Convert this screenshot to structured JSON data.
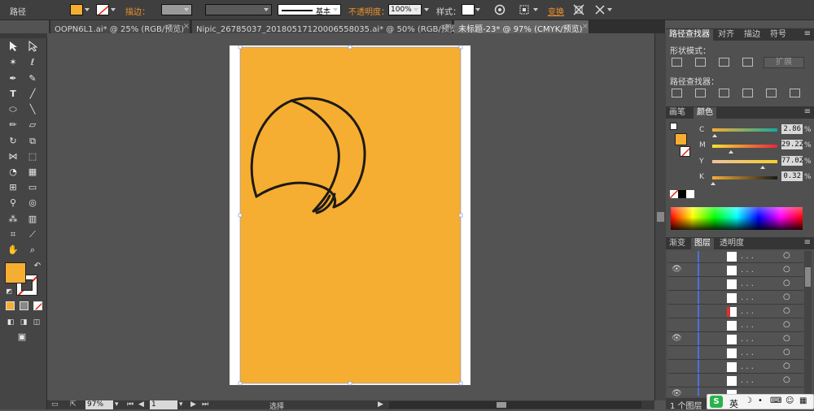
{
  "control": {
    "selection_label": "路径",
    "stroke_label": "描边：",
    "stroke_profile": "基本",
    "opacity_label": "不透明度：",
    "opacity": "100%",
    "style_label": "样式：",
    "transform_label": "变换",
    "fill_color": "#f6ae32"
  },
  "tabs": [
    {
      "label": "OOPN6L1.ai* @ 25% (RGB/预览)"
    },
    {
      "label": "Nipic_26785037_20180517120006558035.ai* @ 50% (RGB/预览)"
    },
    {
      "label": "未标题-23* @ 97% (CMYK/预览)"
    }
  ],
  "panels": {
    "pathfinder_tabs": [
      "路径查找器",
      "对齐",
      "描边",
      "符号"
    ],
    "shape_modes_label": "形状模式：",
    "expand_label": "扩展",
    "pathfinder_label": "路径查找器：",
    "color_tabs": [
      "画笔",
      "颜色"
    ],
    "cmyk": [
      {
        "label": "C",
        "value": "2.86"
      },
      {
        "label": "M",
        "value": "29.22"
      },
      {
        "label": "Y",
        "value": "77.02"
      },
      {
        "label": "K",
        "value": "0.32"
      }
    ],
    "pct": "%",
    "layer_tabs": [
      "渐变",
      "图层",
      "透明度"
    ],
    "layers_count": "1 个图层"
  },
  "status": {
    "zoom": "97%",
    "artboard": "1",
    "mode": "选择"
  },
  "ime": {
    "lang": "英"
  }
}
